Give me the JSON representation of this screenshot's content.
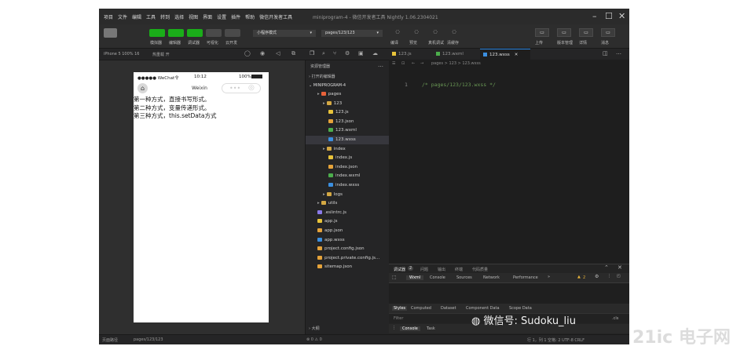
{
  "title_bar": {
    "menu": [
      "项目",
      "文件",
      "编辑",
      "工具",
      "转到",
      "选择",
      "视图",
      "界面",
      "设置",
      "插件",
      "帮助",
      "微信开发者工具"
    ],
    "window_title": "miniprogram-4 - 微信开发者工具 Nightly 1.06.2304021"
  },
  "toolbar": {
    "buttons": [
      {
        "label": "模拟器",
        "color": "#1aad19"
      },
      {
        "label": "编辑器",
        "color": "#1aad19"
      },
      {
        "label": "调试器",
        "color": "#1aad19"
      },
      {
        "label": "可视化",
        "color": "#4a4a4a"
      },
      {
        "label": "云开发",
        "color": "#4a4a4a"
      }
    ],
    "mode_select": "小程序模式",
    "page_select": "pages/123/123",
    "center_labels": [
      "编译",
      "预览",
      "真机调试",
      "清缓存"
    ],
    "right_labels": [
      "上传",
      "版本管理",
      "详情",
      "消息"
    ]
  },
  "strip": {
    "device": "iPhone 5 100% 16",
    "hotreload": "热重载 开"
  },
  "simulator": {
    "status_carrier": "●●●●● WeChat令",
    "status_time": "10:12",
    "status_battery": "100%",
    "nav_title": "Weixin",
    "lines": [
      "第一种方式，直接书写形式。",
      "第二种方式，变量传递形式。",
      "第三种方式，this.setData方式"
    ]
  },
  "explorer": {
    "header": "资源管理器",
    "open_editors": "打开的编辑器",
    "project": "MINIPROGRAM-4",
    "items": [
      {
        "label": "pages",
        "icon": "folder-red-icon",
        "indent": 1
      },
      {
        "label": "123",
        "icon": "folder-icon",
        "indent": 2
      },
      {
        "label": "123.js",
        "icon": "js-icon",
        "indent": 3
      },
      {
        "label": "123.json",
        "icon": "json-icon",
        "indent": 3
      },
      {
        "label": "123.wxml",
        "icon": "wxml-icon",
        "indent": 3
      },
      {
        "label": "123.wxss",
        "icon": "wxss-icon",
        "indent": 3
      },
      {
        "label": "index",
        "icon": "folder-icon",
        "indent": 2
      },
      {
        "label": "index.js",
        "icon": "js-icon",
        "indent": 3
      },
      {
        "label": "index.json",
        "icon": "json-icon",
        "indent": 3
      },
      {
        "label": "index.wxml",
        "icon": "wxml-icon",
        "indent": 3
      },
      {
        "label": "index.wxss",
        "icon": "wxss-icon",
        "indent": 3
      },
      {
        "label": "logs",
        "icon": "folder-icon",
        "indent": 2
      },
      {
        "label": "utils",
        "icon": "folder-icon",
        "indent": 1
      },
      {
        "label": ".eslintrc.js",
        "icon": "eslint-icon",
        "indent": 1
      },
      {
        "label": "app.js",
        "icon": "js-icon",
        "indent": 1
      },
      {
        "label": "app.json",
        "icon": "json-icon",
        "indent": 1
      },
      {
        "label": "app.wxss",
        "icon": "wxss-icon",
        "indent": 1
      },
      {
        "label": "project.config.json",
        "icon": "json-icon",
        "indent": 1
      },
      {
        "label": "project.private.config.js...",
        "icon": "json-icon",
        "indent": 1
      },
      {
        "label": "sitemap.json",
        "icon": "json-icon",
        "indent": 1
      }
    ],
    "outline": "大纲"
  },
  "editor": {
    "tabs": [
      {
        "label": "123.js",
        "active": false
      },
      {
        "label": "123.wxml",
        "active": false
      },
      {
        "label": "123.wxss",
        "active": true
      }
    ],
    "breadcrumb": "pages > 123 > 123.wxss",
    "line_number": "1",
    "code_line": "/* pages/123/123.wxss */"
  },
  "devtools": {
    "top_tabs": [
      "调试器",
      "问题",
      "输出",
      "终端",
      "代码质量"
    ],
    "top_badge": "2",
    "panel_tabs": [
      "Wxml",
      "Console",
      "Sources",
      "Network",
      "Performance"
    ],
    "warning_count": "2",
    "style_tabs": [
      "Styles",
      "Computed",
      "Dataset",
      "Component Data",
      "Scope Data"
    ],
    "filter_placeholder": "Filter",
    "cls": ".cls",
    "console_tabs": [
      "Console",
      "Task"
    ]
  },
  "status_bar": {
    "left": "页面路径",
    "path": "pages/123/123",
    "right": "行 1，列 1  空格: 2  UTF-8  CRLF",
    "errors": "⊗ 0 ⚠ 0"
  },
  "watermarks": {
    "wechat": "微信号: Sudoku_liu",
    "site": "21ic 电子网",
    "site_sub": "bbs.21ic.com"
  },
  "colors": {
    "accent_green": "#1aad19",
    "active_tab_line": "#2f8ae6",
    "code_comment": "#6a9955"
  }
}
